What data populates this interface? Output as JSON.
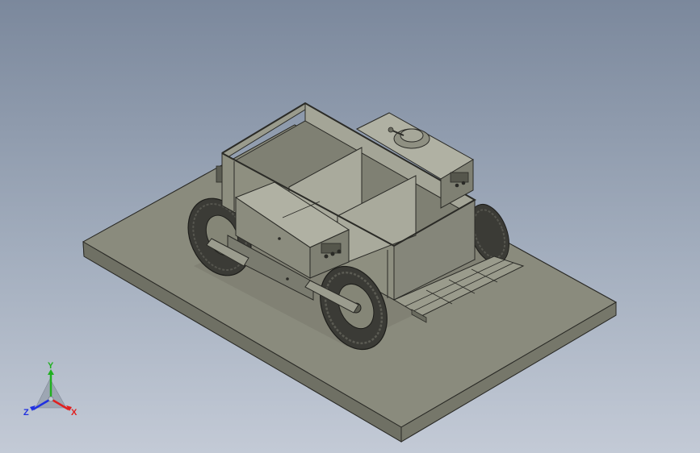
{
  "view": {
    "background_top": "#7b889c",
    "background_bottom": "#c3cad6",
    "model": {
      "type": "wheeled utility cart with open compartment bed, control boxes and fold-down ramp",
      "body_color": "#8e8f80",
      "interior_color": "#a2a395",
      "edge_color": "#2a2a26",
      "base_plate_color": "#7c7d70",
      "tire_color": "#3b3b36"
    }
  },
  "triad": {
    "x_label": "X",
    "y_label": "Y",
    "z_label": "Z",
    "x_color": "#e02020",
    "y_color": "#20b020",
    "z_color": "#2030e0"
  }
}
